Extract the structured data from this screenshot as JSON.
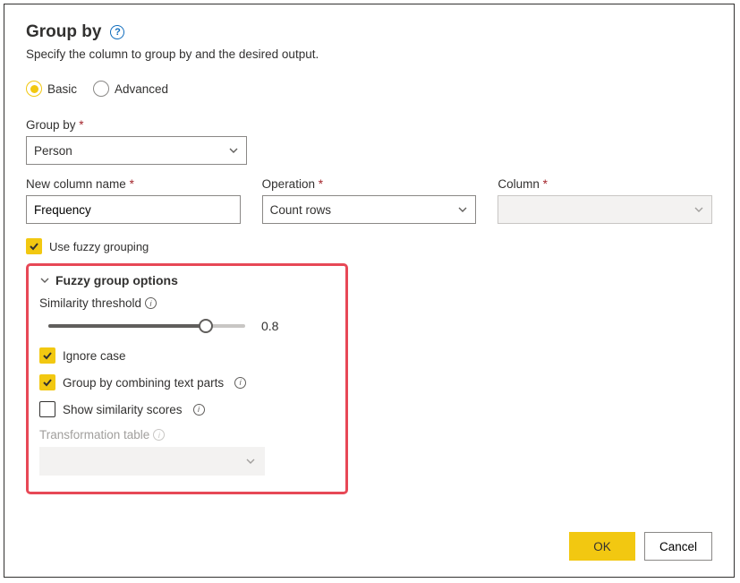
{
  "header": {
    "title": "Group by",
    "subtitle": "Specify the column to group by and the desired output."
  },
  "mode": {
    "basic": "Basic",
    "advanced": "Advanced"
  },
  "labels": {
    "group_by": "Group by",
    "new_col": "New column name",
    "operation": "Operation",
    "column": "Column",
    "use_fuzzy": "Use fuzzy grouping",
    "fuzzy_header": "Fuzzy group options",
    "sim_threshold": "Similarity threshold",
    "ignore_case": "Ignore case",
    "combine_parts": "Group by combining text parts",
    "show_scores": "Show similarity scores",
    "trans_table": "Transformation table"
  },
  "values": {
    "group_by": "Person",
    "new_col": "Frequency",
    "operation": "Count rows",
    "slider": "0.8"
  },
  "footer": {
    "ok": "OK",
    "cancel": "Cancel"
  }
}
